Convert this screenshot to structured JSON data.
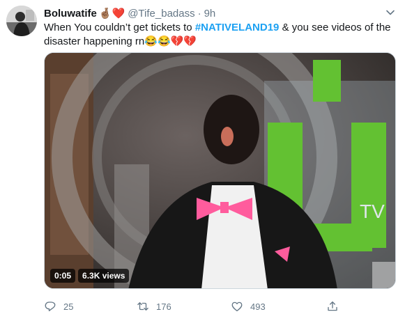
{
  "tweet": {
    "display_name": "Boluwatife",
    "name_emoji": "🤞🏽❤️",
    "handle": "@Tife_badass",
    "separator": "·",
    "time": "9h",
    "text_before": "When You couldn’t get tickets to ",
    "hashtag": "#NATIVELAND19",
    "text_after": " & you see videos of the disaster happening rn",
    "text_emoji": "😂😂💔💔"
  },
  "media": {
    "duration": "0:05",
    "views": "6.3K views",
    "watermark": "TV"
  },
  "actions": {
    "replies": "25",
    "retweets": "176",
    "likes": "493"
  },
  "colors": {
    "link": "#1da1f2",
    "muted": "#657786",
    "logo_green": "#63c132"
  },
  "icons": [
    "chevron-down-icon",
    "reply-icon",
    "retweet-icon",
    "like-icon",
    "share-icon"
  ]
}
